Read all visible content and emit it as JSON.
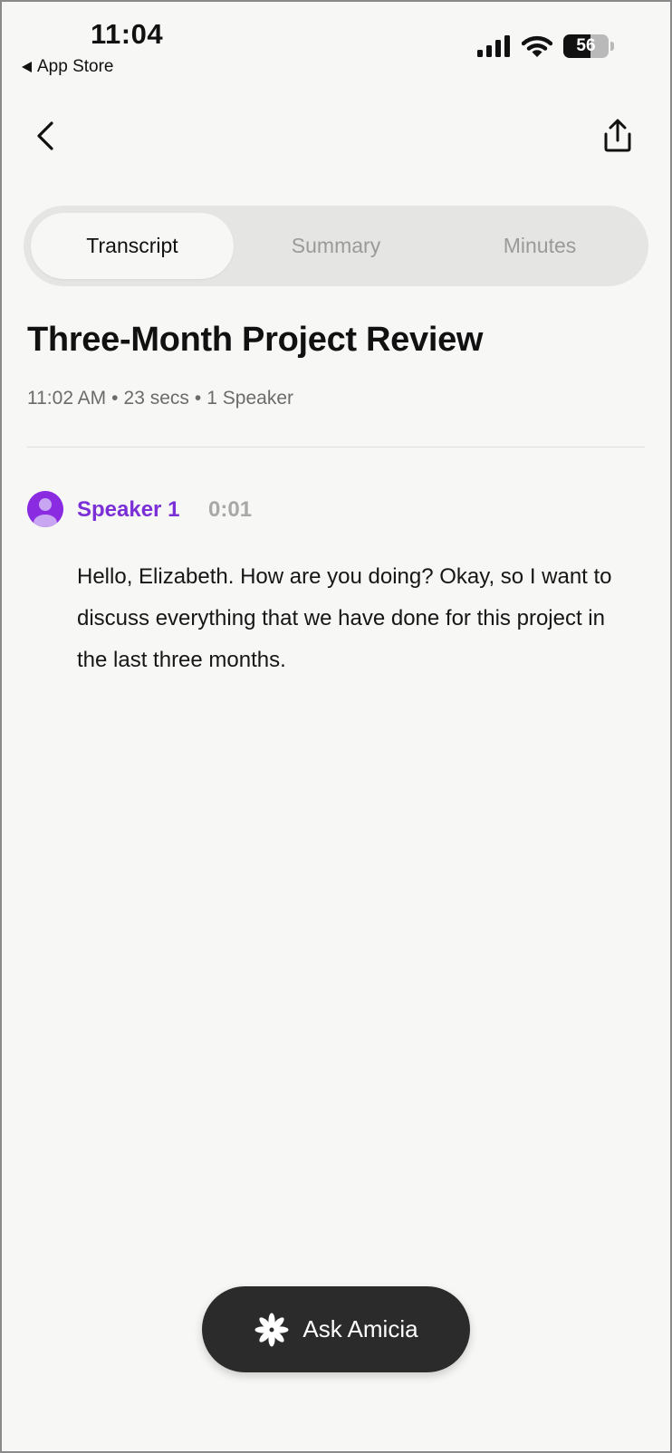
{
  "status_bar": {
    "time": "11:04",
    "back_app": "App Store",
    "battery": "56"
  },
  "nav": {
    "back_icon": "chevron-left-icon",
    "share_icon": "share-icon"
  },
  "tabs": [
    {
      "label": "Transcript",
      "active": true
    },
    {
      "label": "Summary",
      "active": false
    },
    {
      "label": "Minutes",
      "active": false
    }
  ],
  "recording": {
    "title": "Three-Month Project Review",
    "time": "11:02 AM",
    "duration": "23 secs",
    "speakers": "1 Speaker"
  },
  "segments": [
    {
      "speaker": "Speaker 1",
      "timestamp": "0:01",
      "text": "Hello, Elizabeth. How are you doing? Okay, so I want to discuss everything that we have done for this project in the last three months."
    }
  ],
  "ask_button": {
    "label": "Ask Amicia",
    "icon": "sparkle-flower-icon"
  },
  "colors": {
    "background": "#f7f7f5",
    "accent": "#7b2fd6",
    "button_dark": "#2b2b2b"
  }
}
